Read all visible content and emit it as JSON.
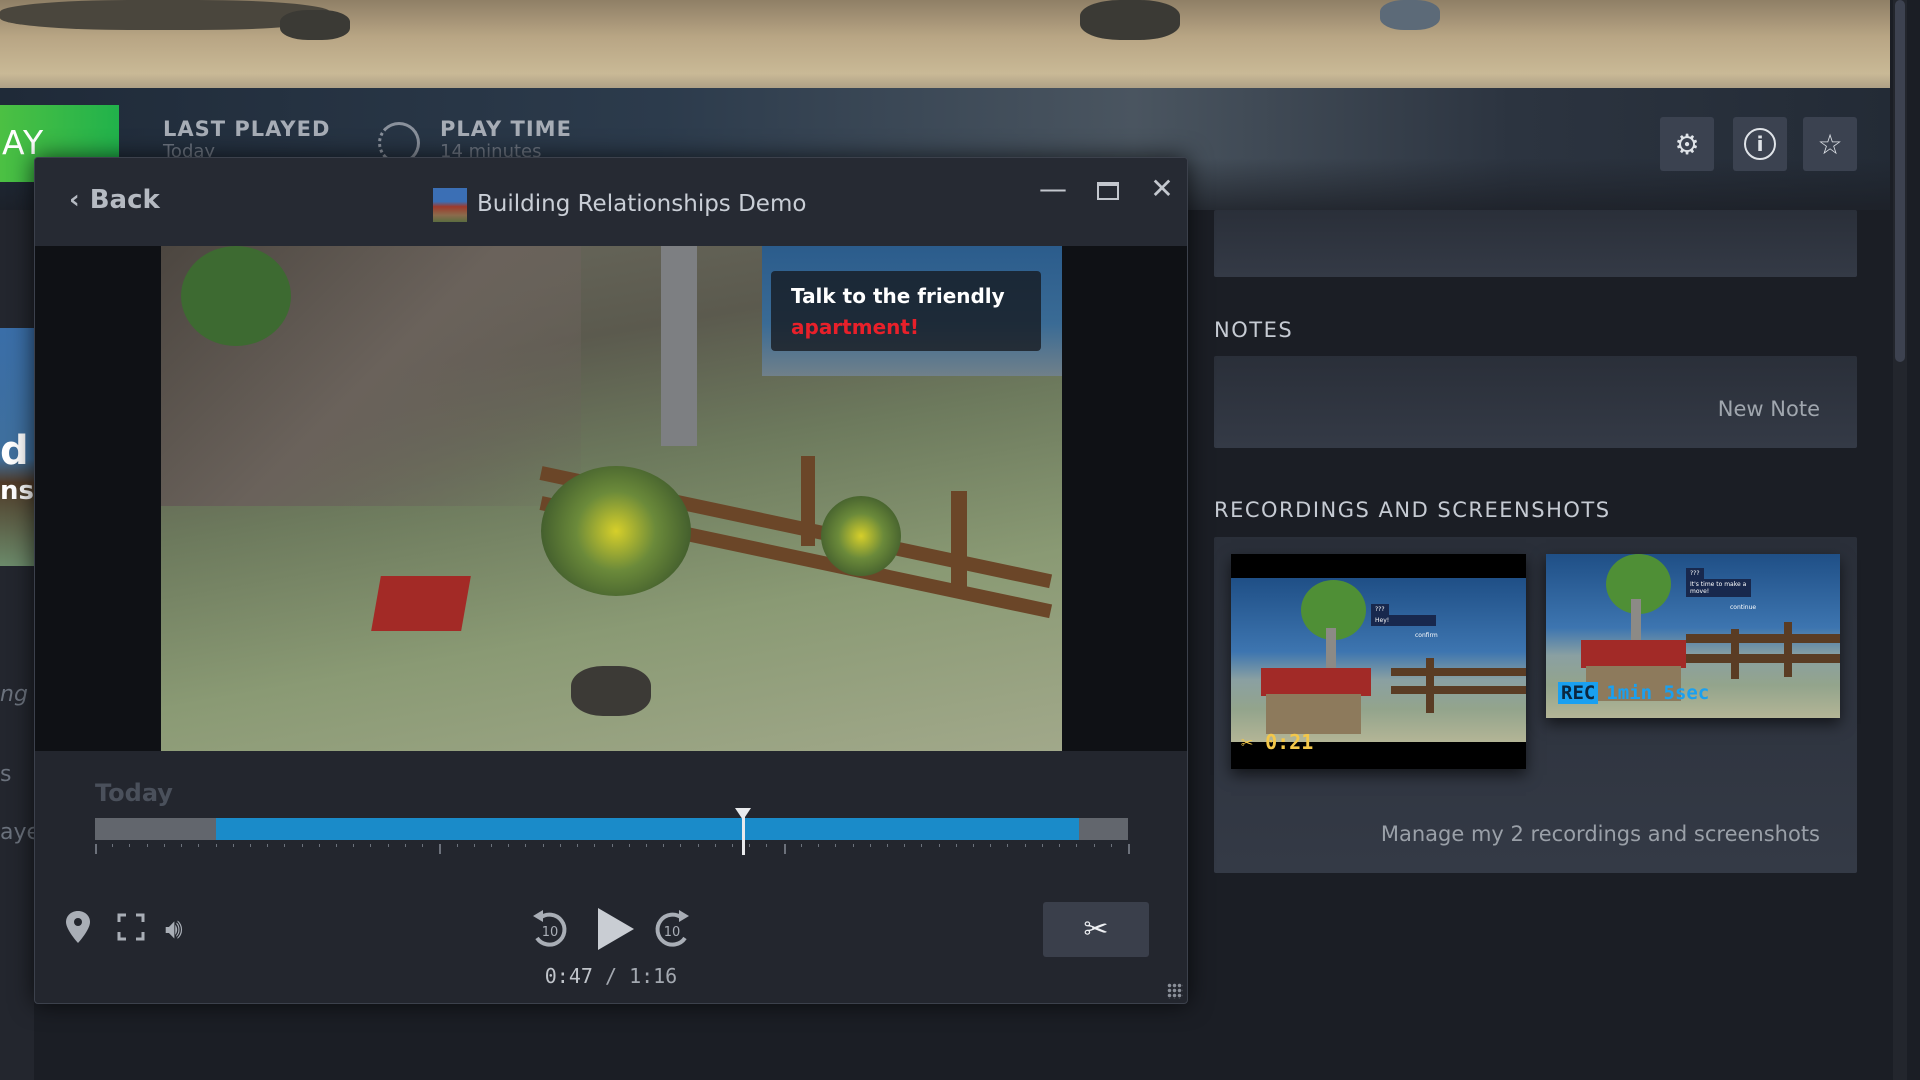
{
  "header": {
    "play_label": "AY",
    "last_played_label": "LAST PLAYED",
    "last_played_value": "Today",
    "play_time_label": "PLAY TIME",
    "play_time_value": "14 minutes",
    "icons": [
      "gear-icon",
      "info-icon",
      "star-icon"
    ]
  },
  "left_partial": {
    "capsule_text_1": "d",
    "capsule_text_2": "ns",
    "line_1": "ng c",
    "line_2": "s",
    "line_3": "ayed"
  },
  "notes": {
    "heading": "NOTES",
    "new_note": "New Note"
  },
  "recordings": {
    "heading": "RECORDINGS AND SCREENSHOTS",
    "clip_duration": "0:21",
    "recording_badge": "REC",
    "recording_duration": "1min 5sec",
    "dialog_1_name": "???",
    "dialog_1_text": "Hey!",
    "dialog_1_button": "confirm",
    "dialog_2_name": "???",
    "dialog_2_text": "It's time to make a move!",
    "dialog_2_button": "continue",
    "manage_link": "Manage my 2 recordings and screenshots"
  },
  "player": {
    "back_label": "Back",
    "title": "Building Relationships Demo",
    "caption_line1": "Talk to the friendly",
    "caption_line2": "apartment!",
    "timeline_label": "Today",
    "clip_start_fraction": 0.117,
    "clip_end_fraction": 0.953,
    "playhead_fraction": 0.627,
    "current_time": "0:47",
    "separator": "/",
    "total_time": "1:16",
    "accent": "#1a8bc9"
  }
}
